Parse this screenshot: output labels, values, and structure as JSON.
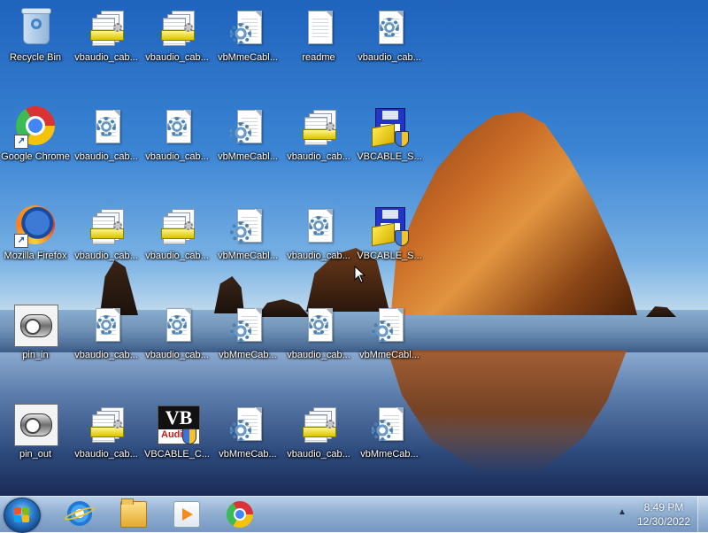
{
  "desktop": {
    "icons": [
      {
        "label": "Recycle Bin",
        "icon": "recycle-bin-icon"
      },
      {
        "label": "vbaudio_cab...",
        "icon": "setup-information-icon"
      },
      {
        "label": "vbaudio_cab...",
        "icon": "setup-information-icon"
      },
      {
        "label": "vbMmeCabl...",
        "icon": "settings-file-icon"
      },
      {
        "label": "readme",
        "icon": "text-document-icon"
      },
      {
        "label": "vbaudio_cab...",
        "icon": "settings-file-icon"
      },
      {
        "label": "Google Chrome",
        "icon": "chrome-icon"
      },
      {
        "label": "vbaudio_cab...",
        "icon": "settings-file-icon"
      },
      {
        "label": "vbaudio_cab...",
        "icon": "settings-file-icon"
      },
      {
        "label": "vbMmeCabl...",
        "icon": "settings-file-icon"
      },
      {
        "label": "vbaudio_cab...",
        "icon": "setup-information-icon"
      },
      {
        "label": "VBCABLE_S...",
        "icon": "setup-installer-icon"
      },
      {
        "label": "Mozilla Firefox",
        "icon": "firefox-icon"
      },
      {
        "label": "vbaudio_cab...",
        "icon": "setup-information-icon"
      },
      {
        "label": "vbaudio_cab...",
        "icon": "setup-information-icon"
      },
      {
        "label": "vbMmeCabl...",
        "icon": "settings-file-icon"
      },
      {
        "label": "vbaudio_cab...",
        "icon": "settings-file-icon"
      },
      {
        "label": "VBCABLE_S...",
        "icon": "setup-installer-icon"
      },
      {
        "label": "pin_in",
        "icon": "image-thumbnail-icon"
      },
      {
        "label": "vbaudio_cab...",
        "icon": "settings-file-icon"
      },
      {
        "label": "vbaudio_cab...",
        "icon": "settings-file-icon"
      },
      {
        "label": "vbMmeCab...",
        "icon": "settings-file-icon"
      },
      {
        "label": "vbaudio_cab...",
        "icon": "settings-file-icon"
      },
      {
        "label": "vbMmeCabl...",
        "icon": "settings-file-icon"
      },
      {
        "label": "pin_out",
        "icon": "image-thumbnail-icon"
      },
      {
        "label": "vbaudio_cab...",
        "icon": "setup-information-icon"
      },
      {
        "label": "VBCABLE_C...",
        "icon": "vb-audio-app-icon"
      },
      {
        "label": "vbMmeCab...",
        "icon": "settings-file-icon"
      },
      {
        "label": "vbaudio_cab...",
        "icon": "setup-information-icon"
      },
      {
        "label": "vbMmeCab...",
        "icon": "settings-file-icon"
      }
    ]
  },
  "taskbar": {
    "start_icon": "windows-start-orb-icon",
    "pinned": [
      {
        "name": "Internet Explorer",
        "icon": "internet-explorer-icon"
      },
      {
        "name": "Windows Explorer",
        "icon": "folder-icon"
      },
      {
        "name": "Windows Media Player",
        "icon": "media-player-icon"
      },
      {
        "name": "Google Chrome",
        "icon": "chrome-icon"
      }
    ],
    "clock": {
      "time": "8:49 PM",
      "date": "12/30/2022"
    },
    "tray_arrow_icon": "chevron-up-icon"
  }
}
